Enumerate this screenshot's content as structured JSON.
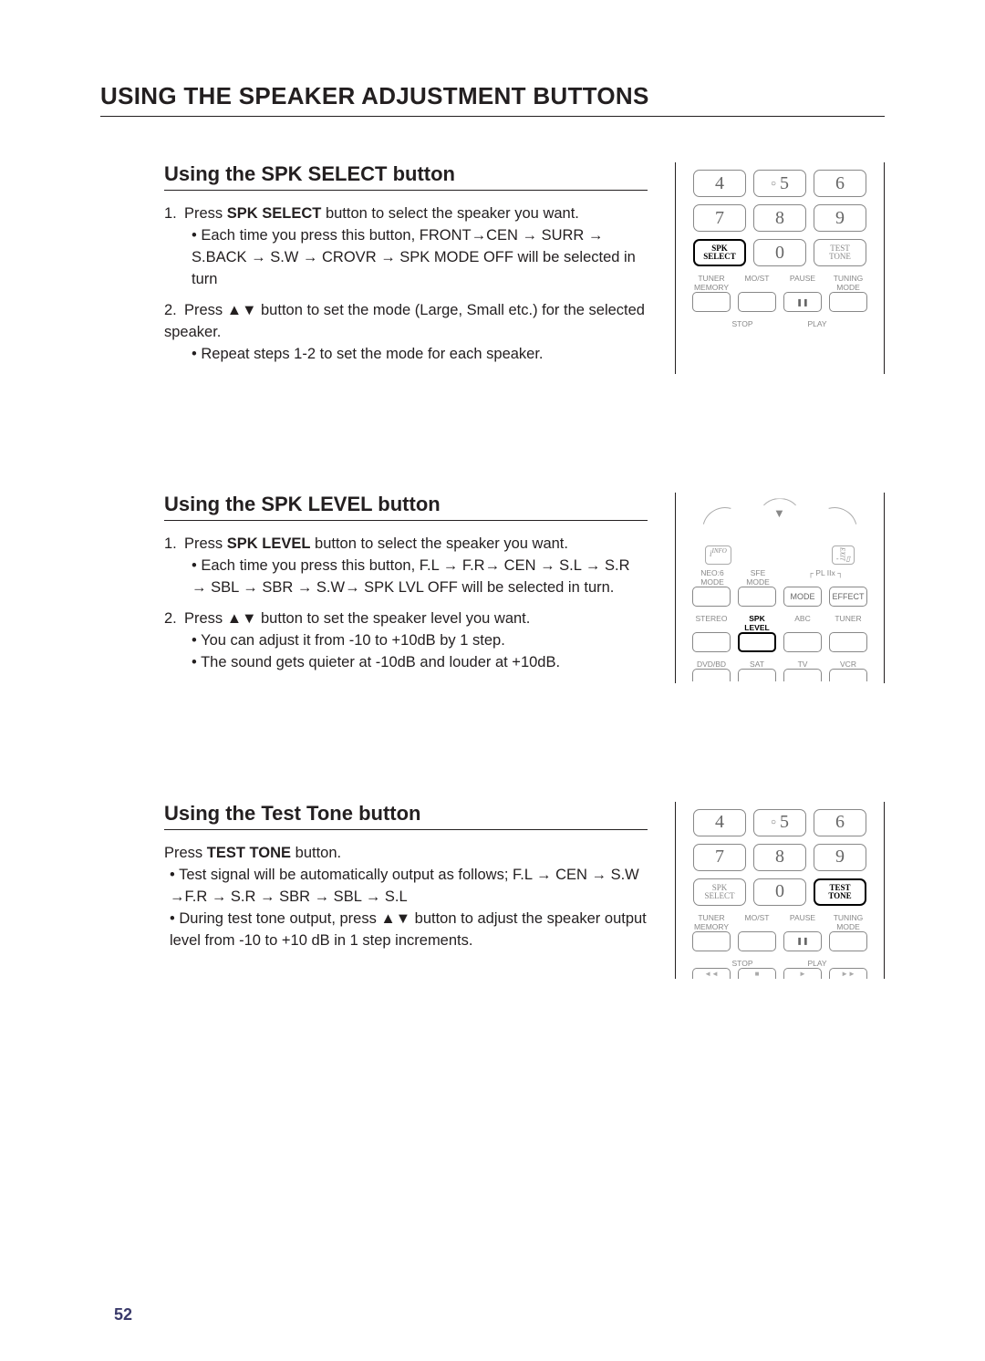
{
  "page": {
    "title": "USING THE SPEAKER ADJUSTMENT BUTTONS",
    "number": "52"
  },
  "section1": {
    "title": "Using the SPK SELECT button",
    "step1_prefix": "1.",
    "step1_text_a": "Press ",
    "step1_bold": "SPK SELECT",
    "step1_text_b": " button to select the speaker you want.",
    "step1_bullet": "Each time you press this button,  FRONT→CEN → SURR → S.BACK → S.W → CROVR →    SPK MODE OFF will be selected in turn",
    "step2_prefix": "2.",
    "step2_text": "Press ▲▼ button to set the mode (Large, Small etc.) for the selected speaker.",
    "step2_bullet": "Repeat steps 1-2 to set the mode for each speaker."
  },
  "section2": {
    "title": "Using the SPK LEVEL button",
    "step1_prefix": "1.",
    "step1_text_a": "Press ",
    "step1_bold": "SPK LEVEL",
    "step1_text_b": " button to select the speaker you want.",
    "step1_bullet": "Each time you press this button, F.L → F.R→ CEN → S.L → S.R → SBL → SBR → S.W→ SPK LVL OFF will be selected in turn.",
    "step2_prefix": "2.",
    "step2_text": "Press ▲▼ button to set the speaker level you want.",
    "step2_bullet1": "You can adjust it from -10 to +10dB by 1 step.",
    "step2_bullet2": "The sound gets quieter at -10dB and louder at +10dB."
  },
  "section3": {
    "title": "Using the Test Tone button",
    "intro_a": "Press ",
    "intro_bold": "TEST TONE",
    "intro_b": " button.",
    "bullet1": "Test signal will be automatically output as follows; F.L → CEN → S.W →F.R → S.R → SBR → SBL →  S.L",
    "bullet2": "During test tone output, press ▲▼ button to adjust the speaker output level from -10 to +10 dB in 1 step increments."
  },
  "remote": {
    "n4": "4",
    "n5": "5",
    "n6": "6",
    "n7": "7",
    "n8": "8",
    "n9": "9",
    "n0": "0",
    "spk_select_line1": "SPK",
    "spk_select_line2": "SELECT",
    "test_tone_line1": "TEST",
    "test_tone_line2": "TONE",
    "lbl_tuner_memory": "TUNER MEMORY",
    "lbl_most": "MO/ST",
    "lbl_pause": "PAUSE",
    "lbl_tuning_mode": "TUNING MODE",
    "lbl_stop": "STOP",
    "lbl_play": "PLAY",
    "pause_icon": "❚❚",
    "lbl_info": "INFO",
    "lbl_exit": "EXIT",
    "lbl_neo6": "NEO:6 MODE",
    "lbl_sfe": "SFE MODE",
    "lbl_plii": "PL IIx",
    "lbl_mode": "MODE",
    "lbl_effect": "EFFECT",
    "lbl_stereo": "STEREO",
    "lbl_spklevel": "SPK LEVEL",
    "lbl_abc": "ABC",
    "lbl_tuner": "TUNER",
    "lbl_dvdbd": "DVD/BD",
    "lbl_sat": "SAT",
    "lbl_tv": "TV",
    "lbl_vcr": "VCR",
    "info_i": "i"
  }
}
